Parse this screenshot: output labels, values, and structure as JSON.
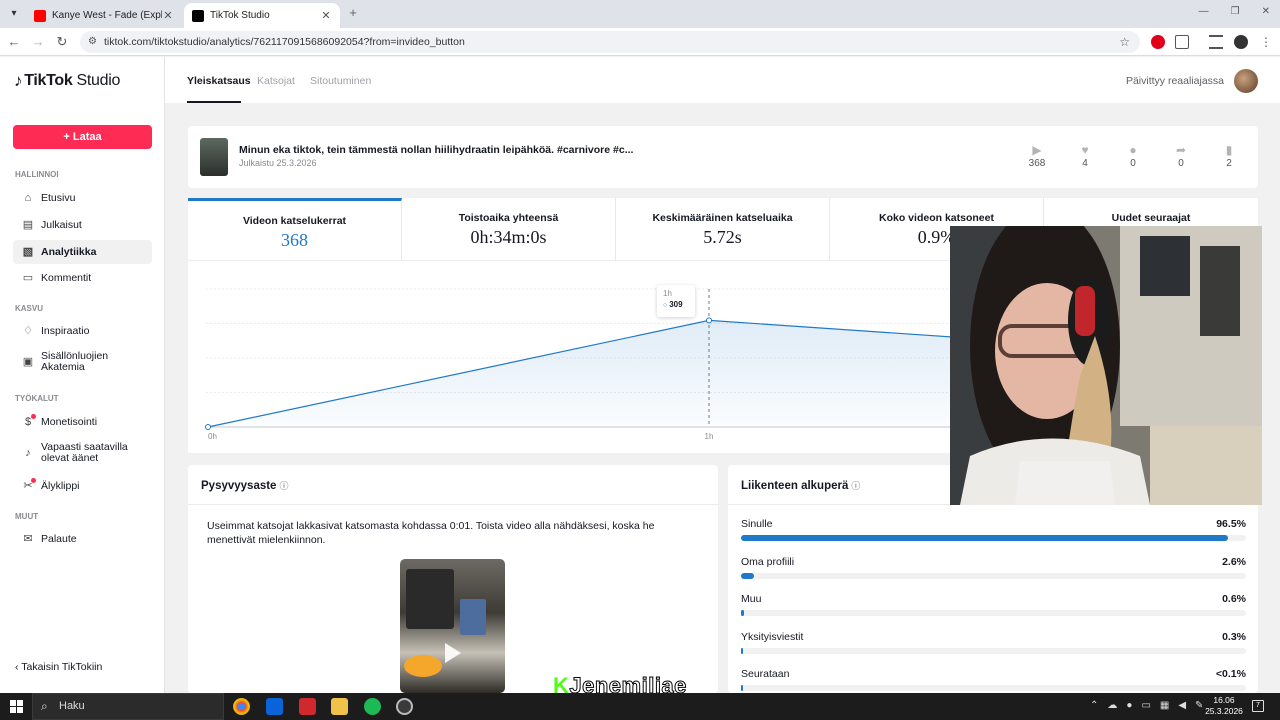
{
  "browser": {
    "tabs": [
      {
        "title": "Kanye West - Fade (Explicit) - YouTube",
        "active": false,
        "favicon_color": "#ff0000"
      },
      {
        "title": "TikTok Studio",
        "active": true,
        "favicon_color": "#000000"
      }
    ],
    "url": "tiktok.com/tiktokstudio/analytics/7621170915686092054?from=invideo_button"
  },
  "sidebar": {
    "logo_brand": "TikTok",
    "logo_suffix": "Studio",
    "upload_label": "Lataa",
    "sections": {
      "manage": "HALLINNOI",
      "grow": "KASVU",
      "tools": "TYÖKALUT",
      "other": "MUUT"
    },
    "items": {
      "home": "Etusivu",
      "posts": "Julkaisut",
      "analytics": "Analytiikka",
      "comments": "Kommentit",
      "inspiration": "Inspiraatio",
      "academy": "Sisällönluojien Akatemia",
      "monetization": "Monetisointi",
      "sounds": "Vapaasti saatavilla olevat äänet",
      "smartclip": "Älyklippi",
      "feedback": "Palaute"
    },
    "back_label": "Takaisin TikTokiin"
  },
  "topbar": {
    "tabs": [
      "Yleiskatsaus",
      "Katsojat",
      "Sitoutuminen"
    ],
    "status": "Päivittyy reaaliajassa"
  },
  "video": {
    "title": "Minun eka tiktok, tein tämmestä nollan hiilihydraatin leipähköä. #carnivore #c...",
    "date": "Julkaistu 25.3.2026",
    "stats": {
      "views": "368",
      "likes": "4",
      "comments": "0",
      "shares": "0",
      "saves": "2"
    }
  },
  "metrics": [
    {
      "label": "Videon katselukerrat",
      "value": "368"
    },
    {
      "label": "Toistoaika yhteensä",
      "value": "0h:34m:0s"
    },
    {
      "label": "Keskimääräinen katseluaika",
      "value": "5.72s"
    },
    {
      "label": "Koko videon katsoneet",
      "value": "0.9%"
    },
    {
      "label": "Uudet seuraajat",
      "value": ""
    }
  ],
  "chart_data": {
    "type": "area",
    "x": [
      "0h",
      "1h",
      "2h"
    ],
    "x_tick_labels": [
      "0h",
      "1h"
    ],
    "values": [
      0,
      309,
      210
    ],
    "ylim": [
      0,
      400
    ],
    "grid": true,
    "color": "#1f78c8",
    "tooltip": {
      "x": "1h",
      "value": "309"
    }
  },
  "retention": {
    "title": "Pysyvyysaste",
    "text": "Useimmat katsojat lakkasivat katsomasta kohdassa 0:01. Toista video alla nähdäksesi, koska he menettivät mielenkiinnon."
  },
  "traffic": {
    "title": "Liikenteen alkuperä",
    "sources": [
      {
        "name": "Sinulle",
        "value": "96.5%",
        "pct": 96.5
      },
      {
        "name": "Oma profiili",
        "value": "2.6%",
        "pct": 2.6
      },
      {
        "name": "Muu",
        "value": "0.6%",
        "pct": 0.6
      },
      {
        "name": "Yksityisviestit",
        "value": "0.3%",
        "pct": 0.3
      },
      {
        "name": "Seurataan",
        "value": "<0.1%",
        "pct": 0.05
      }
    ]
  },
  "overlay": {
    "watermark_k": "K",
    "watermark_name": "Jenemiliae"
  },
  "taskbar": {
    "search_label": "Haku",
    "time": "16.06",
    "date": "25.3.2026",
    "notifications": "7"
  },
  "icons": {
    "home": "home-icon",
    "posts": "posts-icon",
    "analytics": "analytics-icon",
    "comments": "comment-icon",
    "inspiration": "bulb-icon",
    "academy": "academy-icon",
    "monetization": "dollar-icon",
    "sounds": "music-note-icon",
    "smartclip": "scissors-icon",
    "feedback": "mail-icon"
  }
}
